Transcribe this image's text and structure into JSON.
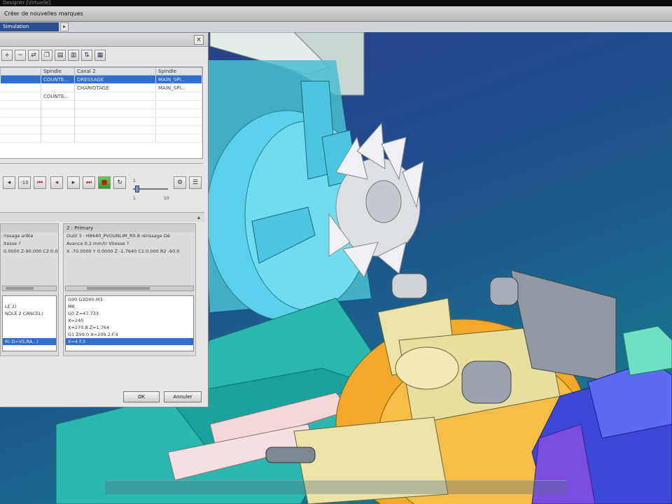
{
  "window": {
    "os_title": "Designer [Virtuelle]",
    "app_title": "Créer de nouvelles marques"
  },
  "tabs": [
    {
      "label": "Simulation"
    }
  ],
  "colors": {
    "accent": "#2c4f8f",
    "selection": "#2f6ed0",
    "viewport_bg": "#1f4d8d"
  },
  "toolbar": {
    "icons": [
      "add-icon",
      "remove-icon",
      "swap-icon",
      "copy-icon",
      "channel1-icon",
      "channel2-icon",
      "sync-icon",
      "table-icon"
    ]
  },
  "grid": {
    "columns": [
      "",
      "Spindle",
      "Canal 2",
      "Spindle"
    ],
    "rows": [
      [
        "",
        "COUNTE...",
        "DRESSAGE",
        "MAIN_SPI..."
      ],
      [
        "",
        "",
        "CHARIOTAGE",
        "MAIN_SPI..."
      ],
      [
        "",
        "COUNTE...",
        "",
        ""
      ],
      [
        "",
        "",
        "",
        ""
      ],
      [
        "",
        "",
        "",
        ""
      ],
      [
        "",
        "",
        "",
        ""
      ],
      [
        "",
        "",
        "",
        ""
      ],
      [
        "",
        "",
        "",
        ""
      ]
    ],
    "selected_row": 0
  },
  "controls": {
    "buttons": [
      {
        "name": "rewind-button",
        "glyph": "◂"
      },
      {
        "name": "step-back-10-button",
        "glyph": "-10"
      },
      {
        "name": "skip-start-button",
        "glyph": "⏮"
      },
      {
        "name": "step-back-button",
        "glyph": "◂"
      },
      {
        "name": "play-button",
        "glyph": "▸"
      },
      {
        "name": "skip-end-button",
        "glyph": "⏭"
      },
      {
        "name": "stop-button",
        "glyph": "■"
      },
      {
        "name": "loop-button",
        "glyph": "↻"
      }
    ],
    "slider": {
      "min_label": "1",
      "mid_label": "1",
      "max_label": "10",
      "value_fraction": 0.05
    }
  },
  "left_pane": {
    "title": "",
    "lines": [
      "rissage arête",
      "itesse ?",
      "0.0000 Z-90.000 C2:0.000"
    ],
    "box_rows": [
      "",
      "LE 2)",
      "NDLE 2 CANCEL)",
      "",
      "",
      "",
      "R(-D=VS,RA...)"
    ],
    "selected_row": 6
  },
  "right_pane": {
    "title": "2 : Primary",
    "lines": [
      "Outil 3 : H8640_PVGUNLIM_R0.8 rérissage Dé",
      "Avance 0.2 mm/tr          Vitesse ?",
      "X -70.0000 Y 0.0000 Z -1.7640 C1:0.000 R2 -90.0"
    ],
    "box_rows": [
      "G90 G3D00 M3",
      "M8",
      "G0 Z=47.733",
      "X=240",
      "X=270.8 Z=1.764",
      "G1 Z99.0 X=209.2 F.4",
      "X=4 F.3"
    ],
    "selected_row": 6
  },
  "buttons": {
    "ok": "OK",
    "cancel": "Annuler"
  }
}
